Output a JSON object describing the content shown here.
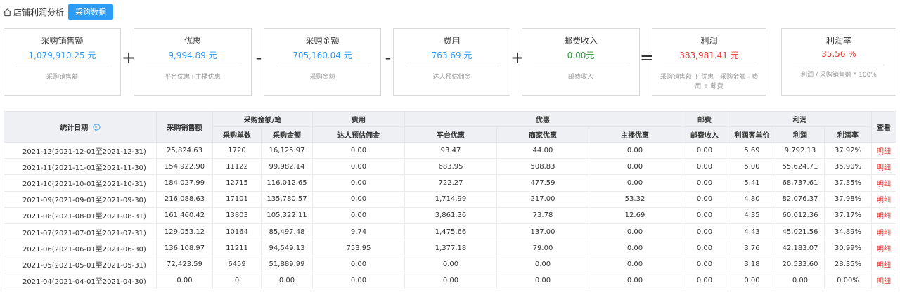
{
  "header": {
    "title": "店铺利润分析",
    "button_label": "采购数据"
  },
  "colors": {
    "blue": "#2d9cf6",
    "green": "#2e9a3c",
    "red": "#e53935"
  },
  "cards": [
    {
      "title": "采购销售额",
      "value": "1,079,910.25 元",
      "desc": "采购销售额",
      "color": "blue"
    },
    {
      "title": "优惠",
      "value": "9,994.89 元",
      "desc": "平台优惠+主播优惠",
      "color": "blue"
    },
    {
      "title": "采购金额",
      "value": "705,160.04 元",
      "desc": "采购金额",
      "color": "blue"
    },
    {
      "title": "费用",
      "value": "763.69 元",
      "desc": "达人预估佣金",
      "color": "blue"
    },
    {
      "title": "邮费收入",
      "value": "0.00元",
      "desc": "邮费收入",
      "color": "green"
    },
    {
      "title": "利润",
      "value": "383,981.41 元",
      "desc": "采购销售额 + 优惠 - 采购金额 - 费用 + 邮费",
      "color": "red"
    },
    {
      "title": "利润率",
      "value": "35.56 %",
      "desc": "利润 / 采购销售额 * 100%",
      "color": "red"
    }
  ],
  "operators": [
    "+",
    "-",
    "-",
    "+",
    "="
  ],
  "table": {
    "group_headers": {
      "date": "统计日期",
      "sales": "采购销售额",
      "purchase": "采购金额/笔",
      "cost": "费用",
      "discount": "优惠",
      "postage": "邮费",
      "profit": "利润",
      "view": "查看"
    },
    "sub_headers": {
      "order_count": "采购单数",
      "purchase_amount": "采购金额",
      "commission": "达人预估佣金",
      "platform_discount": "平台优惠",
      "merchant_discount": "商家优惠",
      "anchor_discount": "主播优惠",
      "postage_income": "邮费收入",
      "profit_per_order": "利润客单价",
      "profit": "利润",
      "profit_rate": "利润率"
    },
    "rows": [
      [
        "2021-12(2021-12-01至2021-12-31)",
        "25,824.63",
        "1720",
        "16,125.97",
        "0.00",
        "93.47",
        "44.00",
        "0.00",
        "0.00",
        "5.69",
        "9,792.13",
        "37.92%",
        "明细"
      ],
      [
        "2021-11(2021-11-01至2021-11-30)",
        "154,922.90",
        "11122",
        "99,982.14",
        "0.00",
        "683.95",
        "508.83",
        "0.00",
        "0.00",
        "5.00",
        "55,624.71",
        "35.90%",
        "明细"
      ],
      [
        "2021-10(2021-10-01至2021-10-31)",
        "184,027.99",
        "12715",
        "116,012.65",
        "0.00",
        "722.27",
        "477.59",
        "0.00",
        "0.00",
        "5.41",
        "68,737.61",
        "37.35%",
        "明细"
      ],
      [
        "2021-09(2021-09-01至2021-09-30)",
        "216,088.63",
        "17101",
        "135,780.57",
        "0.00",
        "1,714.99",
        "217.00",
        "53.32",
        "0.00",
        "4.80",
        "82,076.37",
        "37.98%",
        "明细"
      ],
      [
        "2021-08(2021-08-01至2021-08-31)",
        "161,460.42",
        "13803",
        "105,322.11",
        "0.00",
        "3,861.36",
        "73.78",
        "12.69",
        "0.00",
        "4.35",
        "60,012.36",
        "37.17%",
        "明细"
      ],
      [
        "2021-07(2021-07-01至2021-07-31)",
        "129,053.12",
        "10164",
        "85,497.48",
        "9.74",
        "1,475.66",
        "137.00",
        "0.00",
        "0.00",
        "4.43",
        "45,021.56",
        "34.89%",
        "明细"
      ],
      [
        "2021-06(2021-06-01至2021-06-30)",
        "136,108.97",
        "11211",
        "94,549.13",
        "753.95",
        "1,377.18",
        "79.00",
        "0.00",
        "0.00",
        "3.76",
        "42,183.07",
        "30.99%",
        "明细"
      ],
      [
        "2021-05(2021-05-01至2021-05-31)",
        "72,423.59",
        "6459",
        "51,889.99",
        "0.00",
        "0.00",
        "0.00",
        "0.00",
        "0.00",
        "3.18",
        "20,533.60",
        "28.35%",
        "明细"
      ],
      [
        "2021-04(2021-04-01至2021-04-30)",
        "0.00",
        "0",
        "0.00",
        "0.00",
        "0.00",
        "0.00",
        "0.00",
        "0.00",
        "0.00",
        "0.00",
        "0.00%",
        "明细"
      ]
    ]
  }
}
